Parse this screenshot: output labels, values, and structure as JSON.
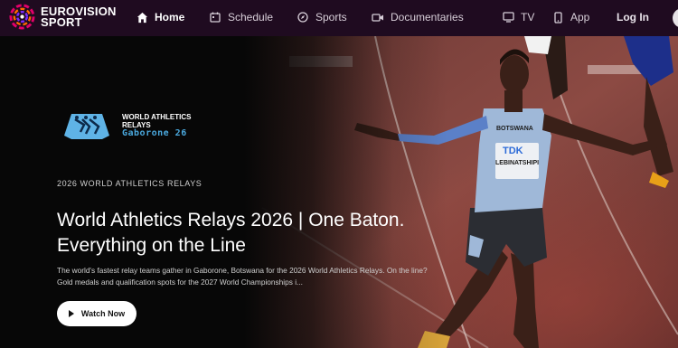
{
  "brand": {
    "line1": "EUROVISION",
    "line2": "SPORT"
  },
  "nav": {
    "home": "Home",
    "schedule": "Schedule",
    "sports": "Sports",
    "documentaries": "Documentaries",
    "tv": "TV",
    "app": "App",
    "login": "Log In"
  },
  "hero": {
    "event_logo": {
      "line1": "WORLD ATHLETICS",
      "line2": "RELAYS",
      "line3": "Gaborone 26"
    },
    "eyebrow": "2026 WORLD ATHLETICS RELAYS",
    "title": "World Athletics Relays 2026 | One Baton. Everything on the Line",
    "description": "The world's fastest relay teams gather in Gaborone, Botswana for the 2026 World Athletics Relays. On the line? Gold medals and qualification spots for the 2027 World Championships i...",
    "cta": "Watch Now",
    "bib": {
      "country": "BOTSWANA",
      "sponsor": "TDK",
      "name": "LEBINATSHIPI"
    }
  },
  "colors": {
    "nav_bg": "#1f0b20",
    "accent": "#e4006a",
    "city_blue": "#4aa8dd"
  }
}
